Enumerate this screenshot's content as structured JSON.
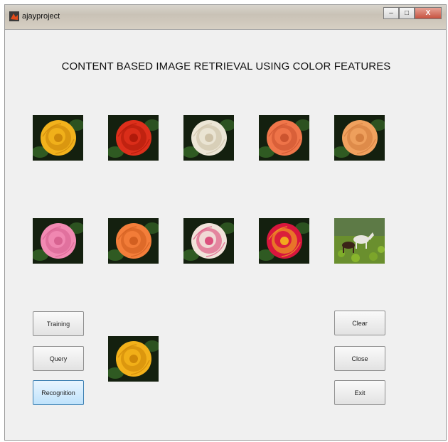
{
  "window": {
    "title": "ajayproject",
    "controls": {
      "minimize_icon": "minimize-icon",
      "maximize_icon": "maximize-icon",
      "close_label": "X"
    }
  },
  "heading": "CONTENT BASED IMAGE RETRIEVAL USING COLOR FEATURES",
  "thumbnails": [
    {
      "name": "yellow-rose",
      "petal": "#f2b21c",
      "center": "#c78108"
    },
    {
      "name": "red-rose",
      "petal": "#dd2f1b",
      "center": "#a81808"
    },
    {
      "name": "white-rose",
      "petal": "#ece6d6",
      "center": "#c9bca0"
    },
    {
      "name": "coral-rose",
      "petal": "#f0764a",
      "center": "#c64f2c"
    },
    {
      "name": "peach-rose",
      "petal": "#f0a15e",
      "center": "#d07a3b"
    },
    {
      "name": "pink-rose",
      "petal": "#f28ab3",
      "center": "#d35d8c"
    },
    {
      "name": "orange-rose",
      "petal": "#f47e3a",
      "center": "#cc5a1c"
    },
    {
      "name": "pink-white-rose",
      "petal": "#f1e2da",
      "center": "#d8396f"
    },
    {
      "name": "red-magenta-rose",
      "petal": "#d8163d",
      "center": "#f6c21a"
    },
    {
      "name": "horses-in-field"
    }
  ],
  "query_image": {
    "name": "query-yellow-rose",
    "petal": "#f3b11a",
    "center": "#c98106"
  },
  "buttons": {
    "training": "Training",
    "query": "Query",
    "recognition": "Recognition",
    "clear": "Clear",
    "close": "Close",
    "exit": "Exit"
  }
}
